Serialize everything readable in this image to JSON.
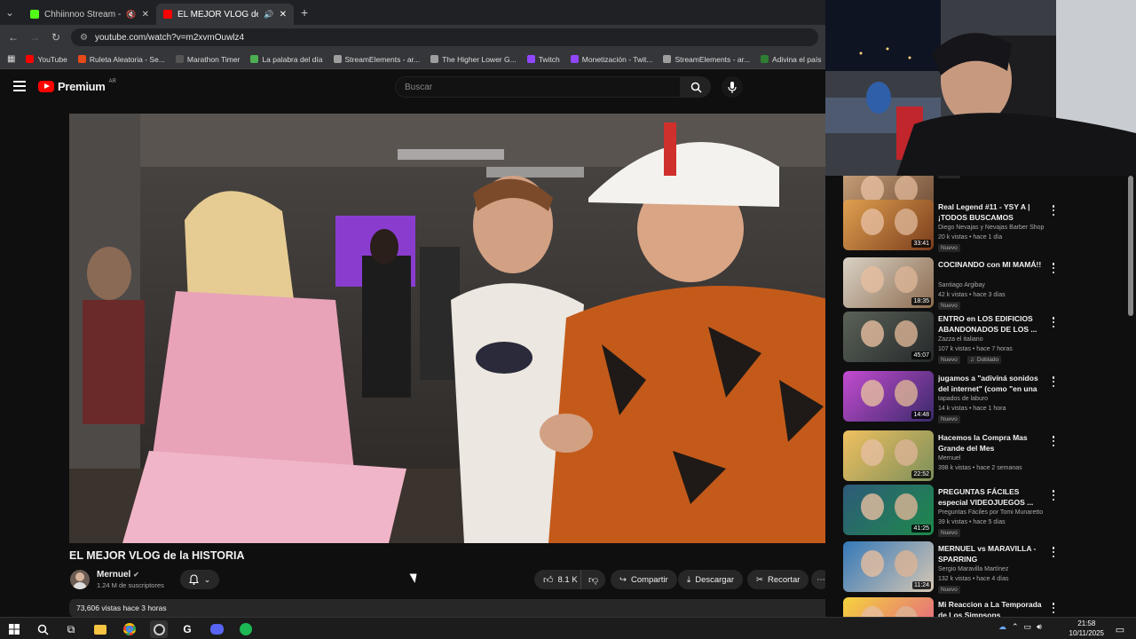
{
  "browser": {
    "tabs": [
      {
        "label": "Chhiinnoo Stream - Watch",
        "favicon_color": "#53fc18",
        "active": false
      },
      {
        "label": "EL MEJOR VLOG de la HISTO",
        "favicon_color": "#ff0000",
        "active": true
      }
    ],
    "url": "youtube.com/watch?v=m2xvmOuwlz4",
    "bookmarks": [
      {
        "label": "YouTube",
        "color": "#ff0000"
      },
      {
        "label": "Ruleta Aleatoria - Se...",
        "color": "#e64a19"
      },
      {
        "label": "Marathon Timer",
        "color": "#555555"
      },
      {
        "label": "La palabra del día",
        "color": "#4caf50"
      },
      {
        "label": "StreamElements - ar...",
        "color": "#9e9e9e"
      },
      {
        "label": "The Higher Lower G...",
        "color": "#9e9e9e"
      },
      {
        "label": "Twitch",
        "color": "#9146ff"
      },
      {
        "label": "Monetización - Twit...",
        "color": "#9146ff"
      },
      {
        "label": "StreamElements - ar...",
        "color": "#9e9e9e"
      },
      {
        "label": "Adivina el país",
        "color": "#2e7d32"
      },
      {
        "label": "Con",
        "color": "#ffffff"
      }
    ]
  },
  "youtube": {
    "logo_text": "Premium",
    "logo_region": "AR",
    "search_placeholder": "Buscar",
    "video": {
      "title": "EL MEJOR VLOG de la HISTORIA",
      "channel": "Mernuel",
      "subscribers": "1.24 M de suscriptores",
      "likes": "8.1 K",
      "share_label": "Compartir",
      "download_label": "Descargar",
      "clip_label": "Recortar",
      "views_date": "73,606 vistas  hace 3 horas"
    },
    "recommendations": [
      {
        "title": "",
        "channel": "",
        "meta": "",
        "badge": "Nuevo",
        "duration": "35:09",
        "thumb": [
          "#c9a27a",
          "#6d4b35"
        ]
      },
      {
        "title": "Real Legend #11 - YSY A | ¡TODOS BUSCAMOS AYUDA!...",
        "channel": "Diego Nevajas y Nevajas Barber Shop",
        "meta": "20 k vistas • hace 1 día",
        "badge": "Nuevo",
        "duration": "33:41",
        "thumb": [
          "#e0a050",
          "#7a3d1c"
        ]
      },
      {
        "title": "COCINANDO con MI MAMÁ!!",
        "channel": "Santiago Argibay",
        "meta": "42 k vistas • hace 3 días",
        "badge": "Nuevo",
        "duration": "18:35",
        "thumb": [
          "#d9d2c5",
          "#8c6b4f"
        ]
      },
      {
        "title": "ENTRO en LOS EDIFICIOS ABANDONADOS DE LOS ...",
        "channel": "Zazza el italiano",
        "meta": "107 k vistas • hace 7 horas",
        "badge": "Nuevo",
        "badge2": "Doblado",
        "duration": "45:07",
        "thumb": [
          "#5a6257",
          "#25282a"
        ]
      },
      {
        "title": "jugamos a \"adiviná sonidos del internet\" (como \"en una nota\" ...",
        "channel": "tapados de laburo",
        "meta": "14 k vistas • hace 1 hora",
        "badge": "Nuevo",
        "duration": "14:48",
        "thumb": [
          "#c34bd0",
          "#3a2a6a"
        ]
      },
      {
        "title": "Hacemos la Compra Mas Grande del Mes",
        "channel": "Mernuel",
        "meta": "398 k vistas • hace 2 semanas",
        "badge": "",
        "duration": "22:52",
        "thumb": [
          "#f0c060",
          "#7b8f5a"
        ]
      },
      {
        "title": "PREGUNTAS FÁCILES especial VIDEOJUEGOS ...",
        "channel": "Preguntas Fáciles por Tomi Munaretto",
        "meta": "39 k vistas • hace 5 días",
        "badge": "Nuevo",
        "duration": "41:25",
        "thumb": [
          "#2e5a7a",
          "#1d8a4a"
        ]
      },
      {
        "title": "MERNUEL vs MARAVILLA - SPARRING",
        "channel": "Sergio Maravilla Martínez",
        "meta": "132 k vistas • hace 4 días",
        "badge": "Nuevo",
        "duration": "11:24",
        "thumb": [
          "#3478b8",
          "#d7c7b3"
        ]
      },
      {
        "title": "Mi Reaccion a La Temporada de Los Simpsons",
        "channel": "",
        "meta": "",
        "badge": "",
        "duration": "",
        "thumb": [
          "#f6d33c",
          "#e05a8a"
        ]
      }
    ]
  },
  "taskbar": {
    "time": "21:58",
    "date": "10/11/2025"
  }
}
